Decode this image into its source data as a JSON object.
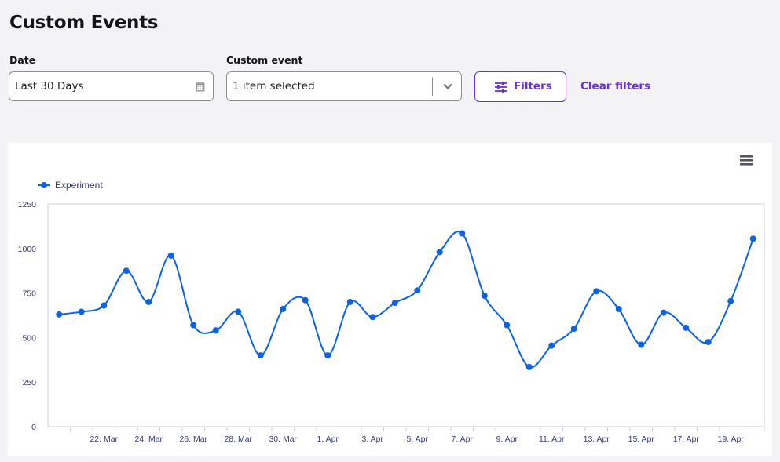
{
  "header": {
    "title": "Custom Events"
  },
  "filters": {
    "date_label": "Date",
    "date_value": "Last 30 Days",
    "date_icon": "calendar-icon",
    "event_label": "Custom event",
    "event_value": "1 item selected",
    "event_icon": "chevron-down-icon",
    "filters_button": "Filters",
    "filters_icon": "sliders-icon",
    "clear_filters": "Clear filters",
    "accent_color": "#6b2fd6"
  },
  "chart_menu_icon": "hamburger-menu-icon",
  "chart_data": {
    "type": "line",
    "title": "",
    "xlabel": "",
    "ylabel": "",
    "ylim": [
      0,
      1250
    ],
    "y_ticks": [
      0,
      250,
      500,
      750,
      1000,
      1250
    ],
    "x_tick_labels": [
      "22. Mar",
      "24. Mar",
      "26. Mar",
      "28. Mar",
      "30. Mar",
      "1. Apr",
      "3. Apr",
      "5. Apr",
      "7. Apr",
      "9. Apr",
      "11. Apr",
      "13. Apr",
      "15. Apr",
      "17. Apr",
      "19. Apr"
    ],
    "grid": false,
    "legend": "top-left",
    "series_color": "#0b64dd",
    "series": [
      {
        "name": "Experiment",
        "x": [
          "20. Mar",
          "21. Mar",
          "22. Mar",
          "23. Mar",
          "24. Mar",
          "25. Mar",
          "26. Mar",
          "27. Mar",
          "28. Mar",
          "29. Mar",
          "30. Mar",
          "31. Mar",
          "1. Apr",
          "2. Apr",
          "3. Apr",
          "4. Apr",
          "5. Apr",
          "6. Apr",
          "7. Apr",
          "8. Apr",
          "9. Apr",
          "10. Apr",
          "11. Apr",
          "12. Apr",
          "13. Apr",
          "14. Apr",
          "15. Apr",
          "16. Apr",
          "17. Apr",
          "18. Apr",
          "19. Apr",
          "20. Apr"
        ],
        "values": [
          630,
          645,
          680,
          875,
          700,
          960,
          570,
          540,
          645,
          400,
          660,
          710,
          400,
          700,
          615,
          695,
          765,
          980,
          1085,
          735,
          570,
          335,
          455,
          550,
          760,
          660,
          460,
          640,
          555,
          475,
          705,
          1055
        ]
      }
    ]
  }
}
